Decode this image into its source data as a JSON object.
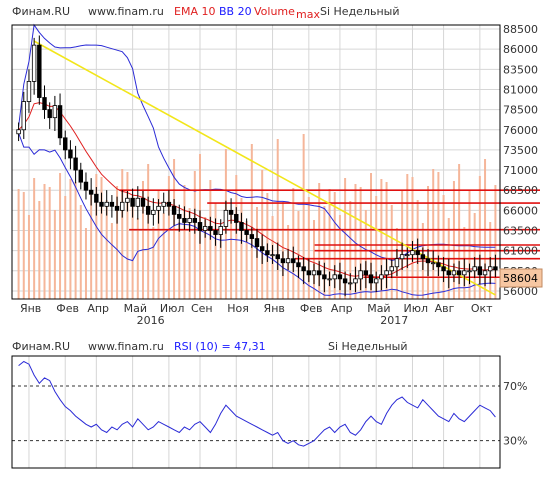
{
  "colors": {
    "background": "#ffffff",
    "frame": "#000000",
    "grid": "#d6d6d6",
    "candle_up": "#ffffff",
    "candle_down": "#000000",
    "volume": "#f5b69a",
    "ema": "#e02020",
    "bollinger": "#2b2bd6",
    "trendline": "#f2e61a",
    "level_line": "#e01010",
    "price_badge": "#f7c7a2",
    "rsi_line": "#2b2bd6",
    "rsi_ref": "#333333",
    "header_blue": "#1a1aff",
    "header_red": "#e02020",
    "header_gray": "#333333"
  },
  "price_header": {
    "source": "Финам.RU",
    "url": "www.finam.ru",
    "ema": "EMA 10",
    "bb": "BB 20",
    "volume": "Volume",
    "max": "max",
    "ticker": "Si Недельный"
  },
  "rsi_header": {
    "source": "Финам.RU",
    "url": "www.finam.ru",
    "rsi": "RSI (10) = 47,31",
    "ticker": "Si Недельный"
  },
  "last_price": "58604",
  "chart_data": [
    {
      "type": "candlestick",
      "title": "Si Недельный",
      "y_ticks": [
        56000,
        58500,
        61000,
        63500,
        66000,
        68500,
        71000,
        73500,
        76000,
        78500,
        81000,
        83500,
        86000,
        88500
      ],
      "ylim": [
        55000,
        89000
      ],
      "x_months": [
        "Янв",
        "Фев",
        "Апр",
        "Май",
        "Июл",
        "Сен",
        "Ноя",
        "Янв",
        "Фев",
        "Апр",
        "Май",
        "Июл",
        "Авг",
        "Окт"
      ],
      "x_years": [
        {
          "label": "2016",
          "at_month": "Май"
        },
        {
          "label": "2017",
          "at_month": "Май"
        }
      ],
      "period": "2015-12 to 2017-11, weekly",
      "close_series": [
        76000,
        79500,
        82000,
        86500,
        80000,
        78500,
        77500,
        79000,
        75000,
        73500,
        72500,
        71000,
        69500,
        68500,
        68000,
        67000,
        66500,
        67000,
        66500,
        66000,
        67000,
        67500,
        66500,
        67500,
        66500,
        65500,
        66000,
        66500,
        67000,
        66500,
        65500,
        65000,
        64500,
        65000,
        64500,
        63500,
        64000,
        63500,
        63000,
        64000,
        66000,
        65500,
        64500,
        63500,
        63000,
        62500,
        61500,
        61000,
        60500,
        60500,
        60000,
        59500,
        60000,
        59500,
        59000,
        58500,
        58000,
        58500,
        58000,
        57500,
        57500,
        58000,
        57500,
        57000,
        57000,
        57500,
        58500,
        58000,
        57000,
        57500,
        58000,
        58500,
        59000,
        60000,
        60500,
        60500,
        61000,
        60500,
        60000,
        59500,
        59500,
        59000,
        58500,
        58000,
        58500,
        58000,
        58500,
        58500,
        59000,
        58000,
        58500,
        59000,
        58604
      ],
      "indicators": [
        "EMA 10",
        "BB 20",
        "Volume"
      ],
      "horizontal_levels": [
        68500,
        66900,
        63600,
        61700,
        61000,
        60000,
        57700
      ],
      "trendline": {
        "from": {
          "week": 3,
          "price": 87000
        },
        "to": {
          "week": 92,
          "price": 55500
        }
      }
    },
    {
      "type": "line",
      "title": "RSI (10) = 47,31",
      "ylim": [
        10,
        92
      ],
      "reference_lines": [
        {
          "value": 70,
          "label": "70%"
        },
        {
          "value": 30,
          "label": "30%"
        }
      ],
      "values": [
        85,
        88,
        86,
        78,
        72,
        76,
        74,
        66,
        60,
        55,
        52,
        48,
        45,
        42,
        40,
        42,
        38,
        36,
        40,
        38,
        42,
        44,
        40,
        46,
        42,
        38,
        40,
        44,
        42,
        40,
        38,
        36,
        40,
        38,
        42,
        44,
        40,
        36,
        42,
        50,
        56,
        52,
        48,
        46,
        44,
        42,
        40,
        38,
        36,
        34,
        36,
        30,
        28,
        30,
        27,
        26,
        28,
        30,
        34,
        38,
        40,
        36,
        40,
        42,
        36,
        34,
        38,
        44,
        48,
        44,
        42,
        50,
        56,
        60,
        62,
        58,
        56,
        54,
        60,
        56,
        52,
        48,
        46,
        44,
        50,
        46,
        44,
        48,
        52,
        56,
        54,
        52,
        47.31
      ]
    }
  ]
}
